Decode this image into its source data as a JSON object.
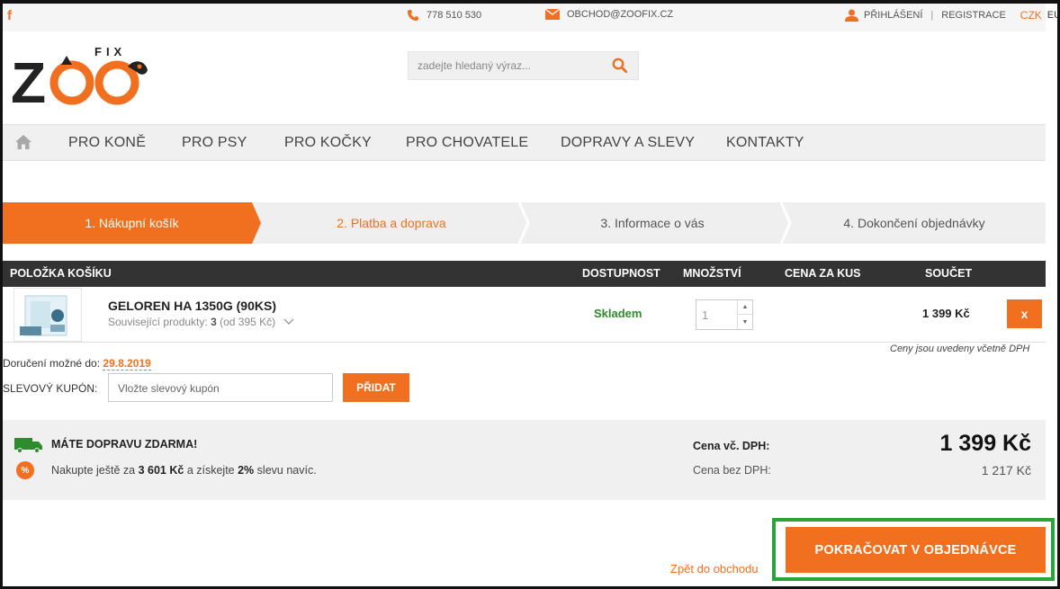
{
  "topbar": {
    "facebook": "f",
    "phone": "778 510 530",
    "email": "OBCHOD@ZOOFIX.CZ",
    "login": "PŘIHLÁŠENÍ",
    "register": "REGISTRACE",
    "currency_active": "CZK",
    "currency_other": "EUR"
  },
  "logo": {
    "main": "ZOO",
    "sup": "FIX"
  },
  "search": {
    "placeholder": "zadejte hledaný výraz..."
  },
  "nav": {
    "items": [
      "PRO KONĚ",
      "PRO PSY",
      "PRO KOČKY",
      "PRO CHOVATELE",
      "DOPRAVY A SLEVY",
      "KONTAKTY"
    ]
  },
  "steps": [
    "1. Nákupní košík",
    "2. Platba a doprava",
    "3. Informace o vás",
    "4. Dokončení objednávky"
  ],
  "table": {
    "headers": {
      "item": "POLOŽKA KOŠÍKU",
      "availability": "DOSTUPNOST",
      "quantity": "MNOŽSTVÍ",
      "unit_price": "CENA ZA KUS",
      "total": "SOUČET"
    },
    "row": {
      "name": "GELOREN HA 1350G (90KS)",
      "related_prefix": "Související produkty:",
      "related_count": "3",
      "related_suffix": "(od 395 Kč)",
      "availability": "Skladem",
      "quantity": "1",
      "total": "1 399 Kč",
      "remove": "x"
    },
    "vat_note": "Ceny jsou uvedeny včetně DPH"
  },
  "delivery": {
    "label": "Doručení možné do:",
    "date": "29.8.2019"
  },
  "coupon": {
    "label": "SLEVOVÝ KUPÓN:",
    "placeholder": "Vložte slevový kupón",
    "button": "PŘIDAT"
  },
  "summary": {
    "free_shipping": "MÁTE DOPRAVU ZDARMA!",
    "buy_more_prefix": "Nakupte ještě za",
    "buy_more_amount": "3 601 Kč",
    "buy_more_middle": "a získejte",
    "buy_more_pct": "2%",
    "buy_more_suffix": "slevu navíc.",
    "pct_badge": "%",
    "price_vat_label": "Cena vč. DPH:",
    "price_vat": "1 399 Kč",
    "price_novat_label": "Cena bez DPH:",
    "price_novat": "1 217 Kč"
  },
  "actions": {
    "back": "Zpět do obchodu",
    "continue": "POKRAČOVAT V OBJEDNÁVCE"
  },
  "colors": {
    "accent": "#f07020",
    "dark": "#333333",
    "success": "#2e8b2e",
    "highlight": "#2aa33a"
  }
}
